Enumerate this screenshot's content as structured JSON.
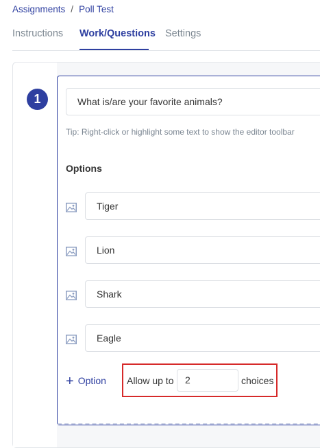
{
  "breadcrumb": {
    "items": [
      "Assignments",
      "Poll Test"
    ],
    "separator": "/"
  },
  "tabs": [
    {
      "label": "Instructions",
      "active": false
    },
    {
      "label": "Work/Questions",
      "active": true
    },
    {
      "label": "Settings",
      "active": false
    }
  ],
  "question": {
    "number": "1",
    "text": "What is/are your favorite animals?",
    "tip": "Tip: Right-click or highlight some text to show the editor toolbar",
    "options_label": "Options",
    "options": [
      "Tiger",
      "Lion",
      "Shark",
      "Eagle"
    ],
    "add_option_label": "Option",
    "allow_prefix": "Allow up to",
    "allow_value": "2",
    "allow_suffix": "choices"
  },
  "colors": {
    "accent": "#2e3fa0",
    "highlight_border": "#d62a2a"
  }
}
